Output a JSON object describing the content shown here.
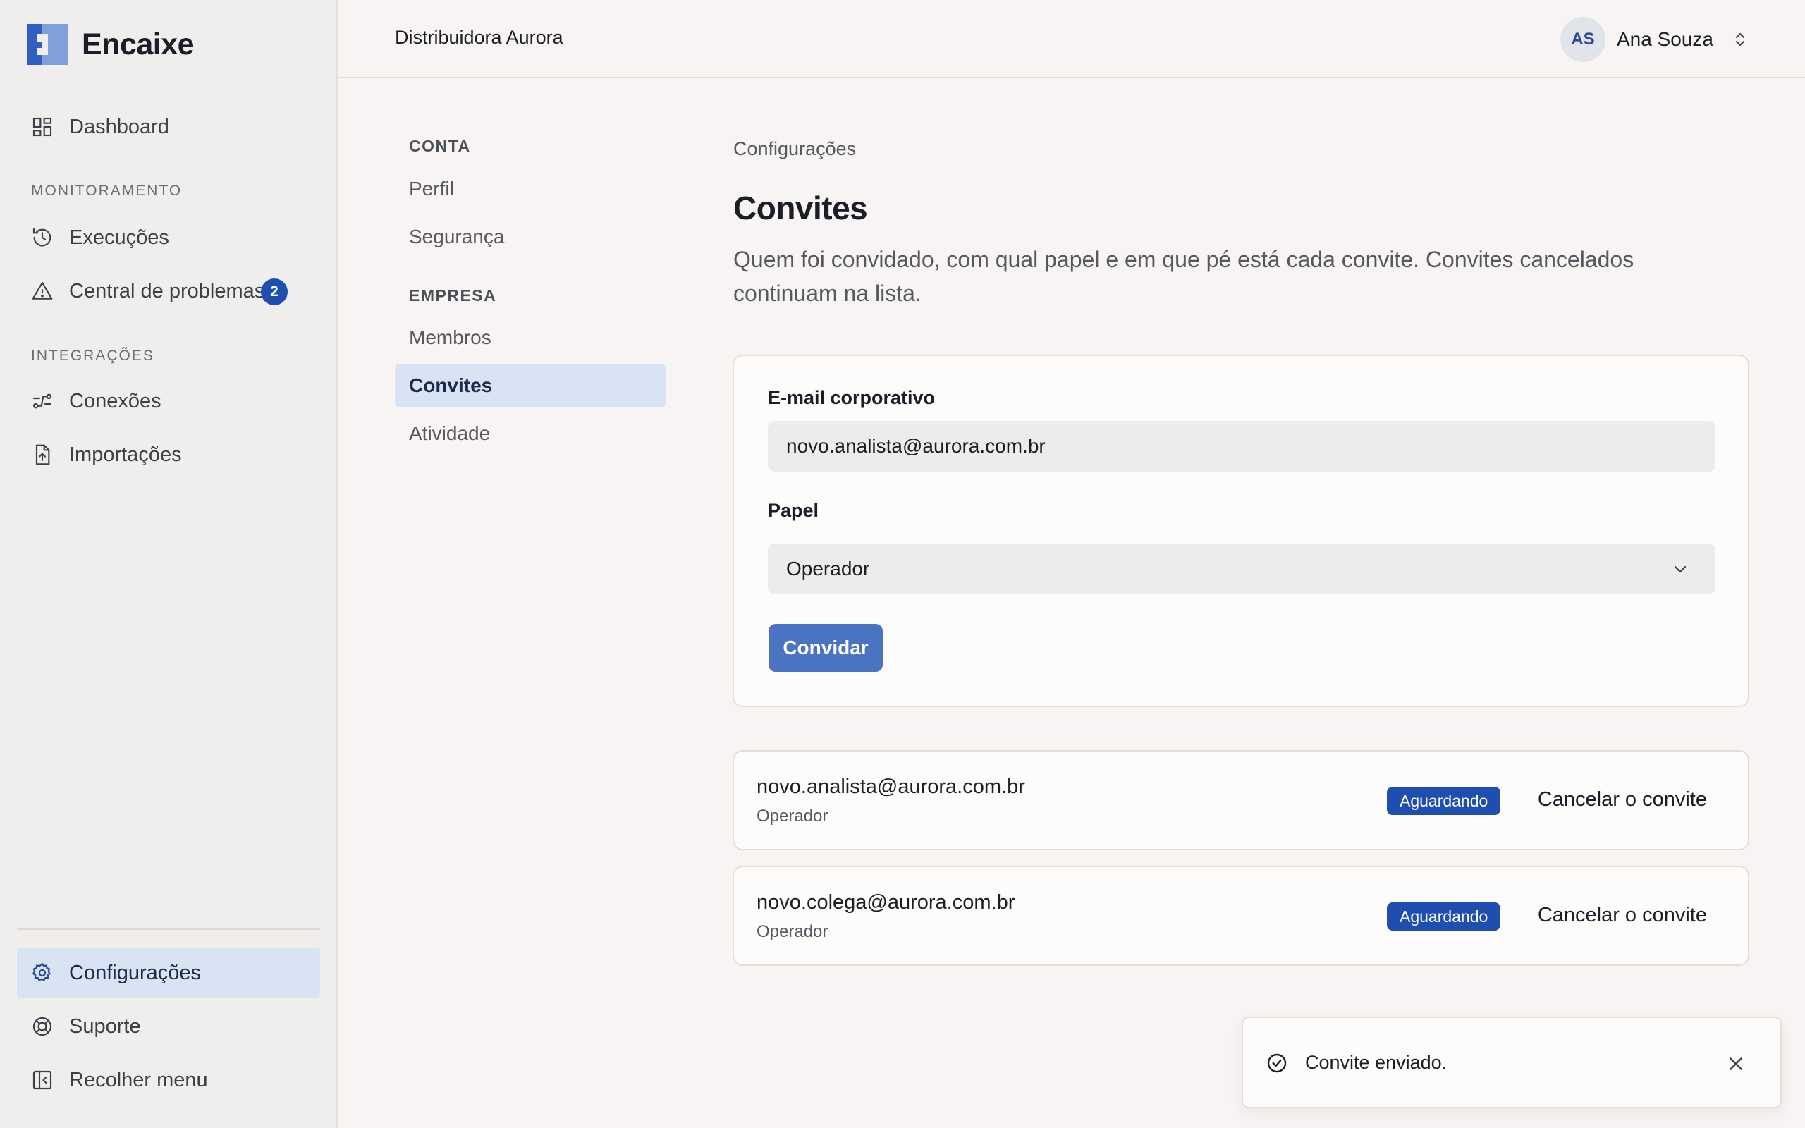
{
  "app": {
    "name": "Encaixe",
    "accent": "#1d4eb0"
  },
  "sidebar": {
    "dashboard": "Dashboard",
    "section_monitoring": "MONITORAMENTO",
    "executions": "Execuções",
    "problems": "Central de problemas",
    "problems_count": "2",
    "section_integrations": "INTEGRAÇÕES",
    "connections": "Conexões",
    "imports": "Importações",
    "settings": "Configurações",
    "support": "Suporte",
    "collapse": "Recolher menu"
  },
  "header": {
    "org": "Distribuidora Aurora",
    "user_initials": "AS",
    "user_name": "Ana Souza"
  },
  "subnav": {
    "section_account": "CONTA",
    "profile": "Perfil",
    "security": "Segurança",
    "section_company": "EMPRESA",
    "members": "Membros",
    "invites": "Convites",
    "activity": "Atividade"
  },
  "main": {
    "breadcrumb": "Configurações",
    "title": "Convites",
    "description": "Quem foi convidado, com qual papel e em que pé está cada convite. Convites cancelados continuam na lista."
  },
  "form": {
    "email_label": "E-mail corporativo",
    "email_value": "novo.analista@aurora.com.br",
    "role_label": "Papel",
    "role_value": "Operador",
    "submit": "Convidar"
  },
  "invites": [
    {
      "email": "novo.analista@aurora.com.br",
      "role": "Operador",
      "status": "Aguardando",
      "action": "Cancelar o convite"
    },
    {
      "email": "novo.colega@aurora.com.br",
      "role": "Operador",
      "status": "Aguardando",
      "action": "Cancelar o convite"
    }
  ],
  "toast": {
    "message": "Convite enviado."
  }
}
